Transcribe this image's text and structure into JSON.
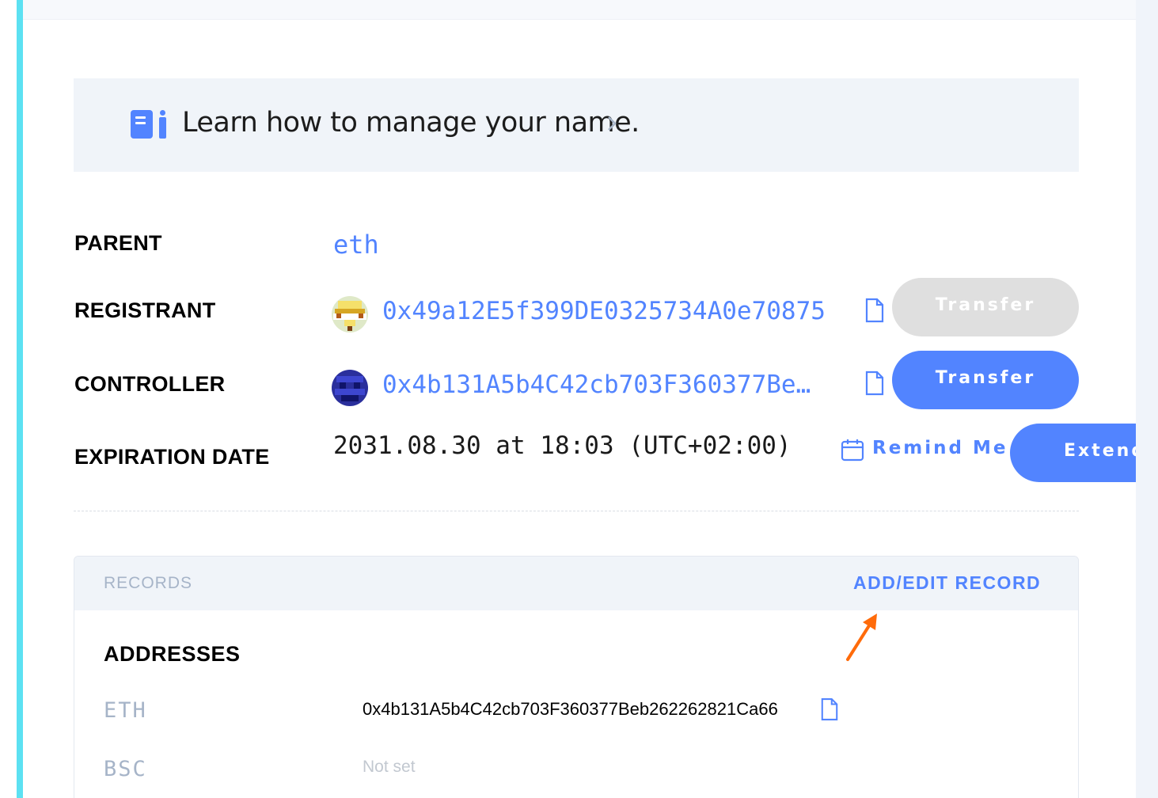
{
  "banner": {
    "text": "Learn how to manage your name."
  },
  "details": {
    "parent": {
      "label": "PARENT",
      "value": "eth"
    },
    "registrant": {
      "label": "REGISTRANT",
      "address": "0x49a12E5f399DE0325734A0e70875",
      "button": "Transfer"
    },
    "controller": {
      "label": "CONTROLLER",
      "address": "0x4b131A5b4C42cb703F360377Be…",
      "button": "Transfer"
    },
    "expiration": {
      "label": "EXPIRATION DATE",
      "value": "2031.08.30 at 18:03 (UTC+02:00)",
      "remind": "Remind Me",
      "button": "Extend"
    }
  },
  "records": {
    "title": "RECORDS",
    "action": "ADD/EDIT RECORD",
    "addresses_title": "ADDRESSES",
    "items": [
      {
        "coin": "ETH",
        "value": "0x4b131A5b4C42cb703F360377Beb262262821Ca66"
      },
      {
        "coin": "BSC",
        "value": "Not set"
      }
    ]
  },
  "colors": {
    "accent": "#5284ff",
    "cyan_bar": "#5ce1f2",
    "annotation_arrow": "#ff6b0a"
  }
}
